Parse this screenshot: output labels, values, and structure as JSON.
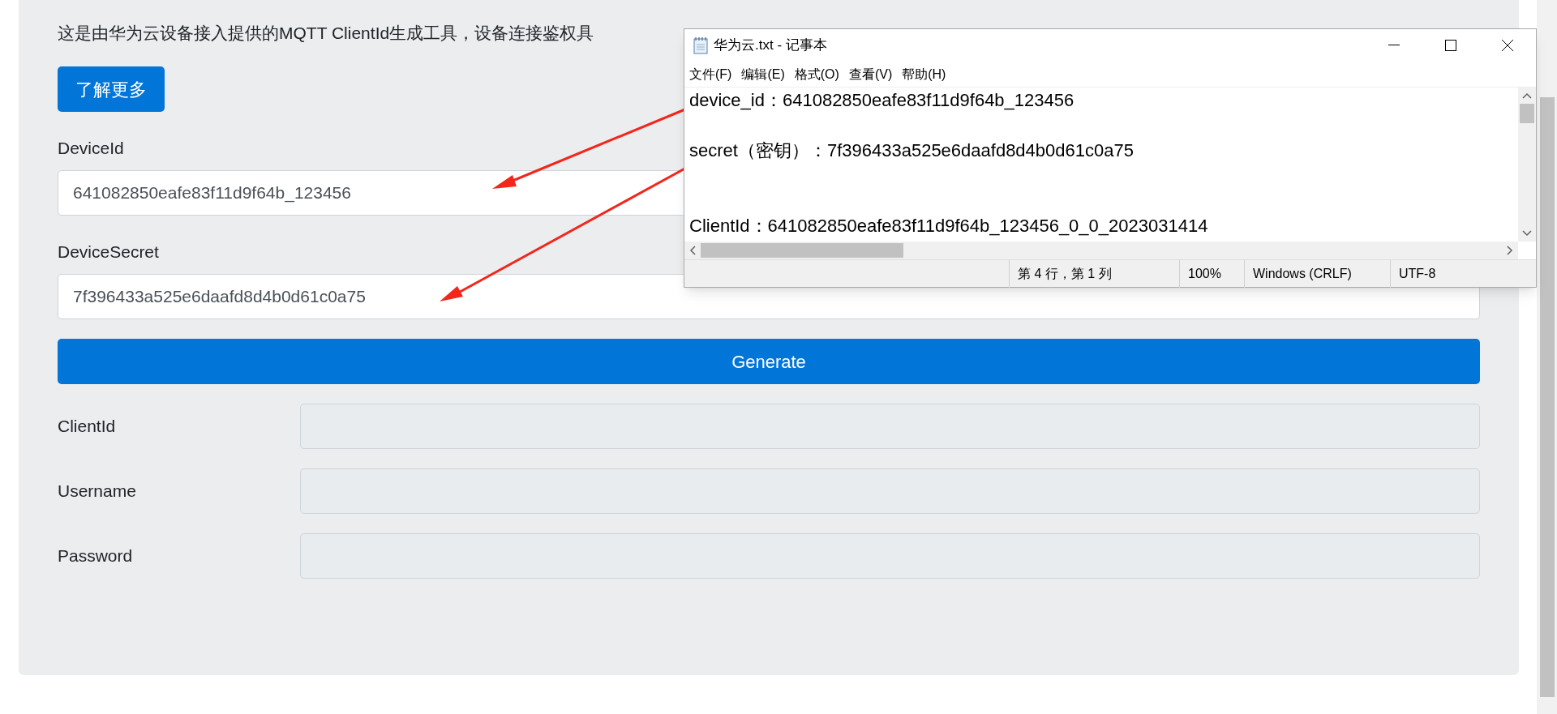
{
  "page": {
    "description": "这是由华为云设备接入提供的MQTT ClientId生成工具，设备连接鉴权具",
    "learn_more_button": "了解更多",
    "inputs": [
      {
        "label": "DeviceId",
        "value": "641082850eafe83f11d9f64b_123456"
      },
      {
        "label": "DeviceSecret",
        "value": "7f396433a525e6daafd8d4b0d61c0a75"
      }
    ],
    "generate_button": "Generate",
    "outputs": [
      {
        "label": "ClientId",
        "disabled": true
      },
      {
        "label": "Username",
        "disabled": true
      },
      {
        "label": "Password",
        "disabled": true
      }
    ]
  },
  "notepad": {
    "title": "华为云.txt - 记事本",
    "menu": [
      "文件(F)",
      "编辑(E)",
      "格式(O)",
      "查看(V)",
      "帮助(H)"
    ],
    "lines": [
      "device_id：641082850eafe83f11d9f64b_123456",
      "secret（密钥）：7f396433a525e6daafd8d4b0d61c0a75",
      "ClientId：641082850eafe83f11d9f64b_123456_0_0_2023031414"
    ],
    "status": [
      "第 4 行，第 1 列",
      "100%",
      "Windows (CRLF)",
      "UTF-8"
    ]
  }
}
